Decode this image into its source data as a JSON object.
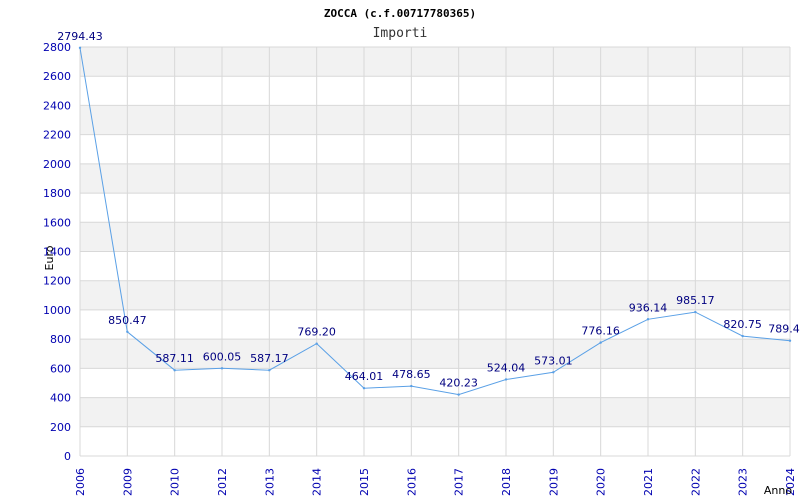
{
  "chart_data": {
    "type": "line",
    "title": "ZOCCA (c.f.00717780365)",
    "subtitle": "Importi",
    "xlabel": "Anno",
    "ylabel": "Euro",
    "categories": [
      "2006",
      "2009",
      "2010",
      "2012",
      "2013",
      "2014",
      "2015",
      "2016",
      "2017",
      "2018",
      "2019",
      "2020",
      "2021",
      "2022",
      "2023",
      "2024"
    ],
    "values": [
      2794.43,
      850.47,
      587.11,
      600.05,
      587.17,
      769.2,
      464.01,
      478.65,
      420.23,
      524.04,
      573.01,
      776.16,
      936.14,
      985.17,
      820.75,
      789.4
    ],
    "value_labels": [
      "2794.43",
      "850.47",
      "587.11",
      "600.05",
      "587.17",
      "769.20",
      "464.01",
      "478.65",
      "420.23",
      "524.04",
      "573.01",
      "776.16",
      "936.14",
      "985.17",
      "820.75",
      "789.4"
    ],
    "yticks": [
      "0",
      "200",
      "400",
      "600",
      "800",
      "1000",
      "1200",
      "1400",
      "1600",
      "1800",
      "2000",
      "2200",
      "2400",
      "2600",
      "2800"
    ],
    "ylim": [
      0,
      2800
    ],
    "grid": true,
    "colors": {
      "line": "#5aa0e6",
      "band": "#f2f2f2",
      "grid": "#d8d8d8",
      "tick_text": "#0000b0",
      "label_text": "#000080"
    }
  }
}
